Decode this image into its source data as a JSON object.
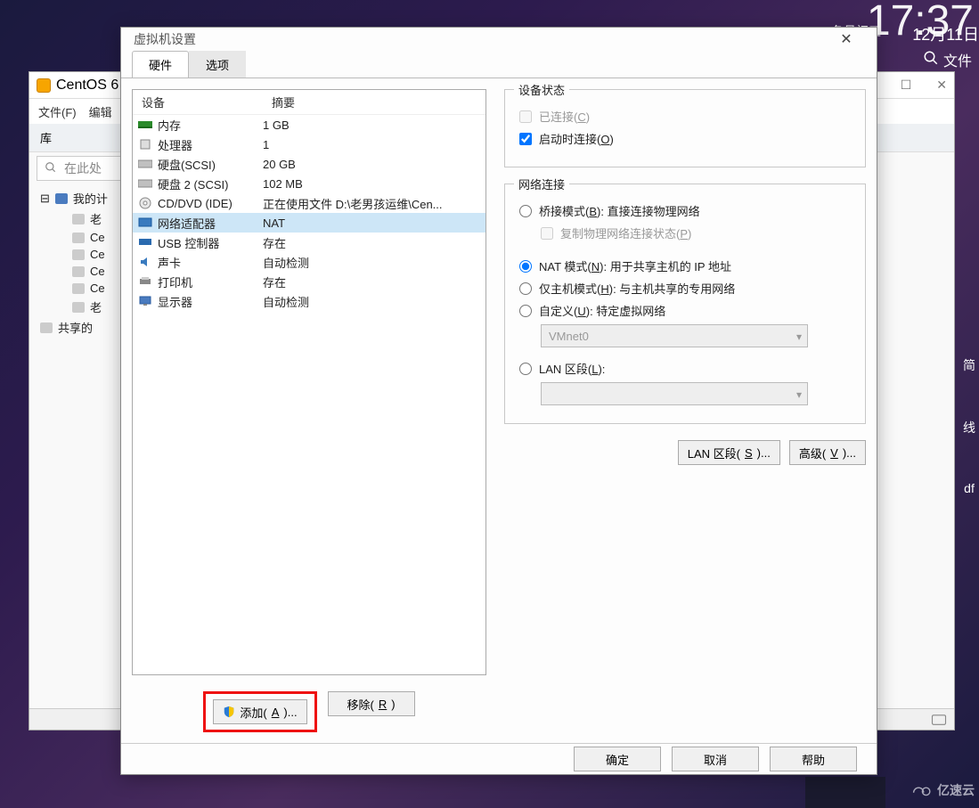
{
  "desktop": {
    "clock": "17:37",
    "lunar": "冬月初五",
    "date": "12月11日",
    "search_label": "文件",
    "side_items": [
      "简",
      "线",
      "df"
    ],
    "logo": "亿速云"
  },
  "vmware": {
    "title_prefix": "CentOS 6",
    "menu": {
      "file": "文件(F)",
      "edit": "编辑"
    },
    "library_header": "库",
    "search_placeholder": "在此处",
    "tree": {
      "root": "我的计",
      "items": [
        "老",
        "Ce",
        "Ce",
        "Ce",
        "Ce",
        "老"
      ],
      "shared": "共享的"
    },
    "winctrl": {
      "max": "☐",
      "close": "✕"
    }
  },
  "dialog": {
    "title": "虚拟机设置",
    "tabs": {
      "hardware": "硬件",
      "options": "选项"
    },
    "columns": {
      "device": "设备",
      "summary": "摘要"
    },
    "hardware": [
      {
        "icon": "memory-icon",
        "name": "内存",
        "summary": "1 GB"
      },
      {
        "icon": "cpu-icon",
        "name": "处理器",
        "summary": "1"
      },
      {
        "icon": "disk-icon",
        "name": "硬盘(SCSI)",
        "summary": "20 GB"
      },
      {
        "icon": "disk-icon",
        "name": "硬盘 2 (SCSI)",
        "summary": "102 MB"
      },
      {
        "icon": "cd-icon",
        "name": "CD/DVD (IDE)",
        "summary": "正在使用文件 D:\\老男孩运维\\Cen..."
      },
      {
        "icon": "net-icon",
        "name": "网络适配器",
        "summary": "NAT"
      },
      {
        "icon": "usb-icon",
        "name": "USB 控制器",
        "summary": "存在"
      },
      {
        "icon": "sound-icon",
        "name": "声卡",
        "summary": "自动检测"
      },
      {
        "icon": "printer-icon",
        "name": "打印机",
        "summary": "存在"
      },
      {
        "icon": "display-icon",
        "name": "显示器",
        "summary": "自动检测"
      }
    ],
    "add_label": "添加(",
    "add_key": "A",
    "add_suffix": ")...",
    "remove_label": "移除(",
    "remove_key": "R",
    "remove_suffix": ")",
    "status_group": "设备状态",
    "connected_label": "已连接(",
    "connected_key": "C",
    "connected_suffix": ")",
    "connect_poweron_label": "启动时连接(",
    "connect_poweron_key": "O",
    "connect_poweron_suffix": ")",
    "net_group": "网络连接",
    "bridged_label": "桥接模式(",
    "bridged_key": "B",
    "bridged_suffix": "): 直接连接物理网络",
    "replicate_label": "复制物理网络连接状态(",
    "replicate_key": "P",
    "replicate_suffix": ")",
    "nat_label": "NAT 模式(",
    "nat_key": "N",
    "nat_suffix": "): 用于共享主机的 IP 地址",
    "hostonly_label": "仅主机模式(",
    "hostonly_key": "H",
    "hostonly_suffix": "): 与主机共享的专用网络",
    "custom_label": "自定义(",
    "custom_key": "U",
    "custom_suffix": "): 特定虚拟网络",
    "custom_net": "VMnet0",
    "lanseg_radio_label": "LAN 区段(",
    "lanseg_radio_key": "L",
    "lanseg_radio_suffix": "):",
    "lanseg_btn_label": "LAN 区段(",
    "lanseg_btn_key": "S",
    "lanseg_btn_suffix": ")...",
    "advanced_label": "高级(",
    "advanced_key": "V",
    "advanced_suffix": ")...",
    "ok": "确定",
    "cancel": "取消",
    "help": "帮助"
  }
}
